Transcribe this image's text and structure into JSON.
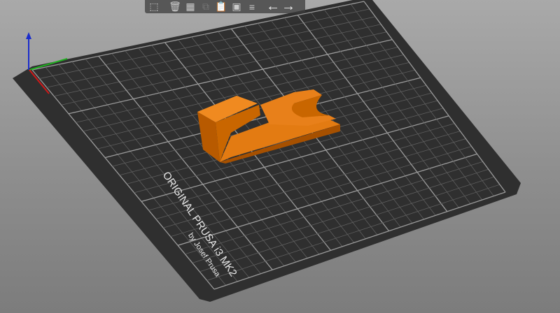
{
  "bed": {
    "label_line1": "ORIGINAL PRUSA i3  MK2",
    "label_line2": "by Josef Prusa"
  },
  "toolbar": {
    "items": [
      {
        "name": "add-object",
        "icon": "cube-plus-icon",
        "glyph": "⬚",
        "enabled": true
      },
      {
        "name": "delete",
        "icon": "trash-icon",
        "glyph": "🗑",
        "enabled": true
      },
      {
        "name": "arrange",
        "icon": "arrange-icon",
        "glyph": "▦",
        "enabled": true
      },
      {
        "name": "copy",
        "icon": "copy-icon",
        "glyph": "⧉",
        "enabled": false
      },
      {
        "name": "paste",
        "icon": "paste-icon",
        "glyph": "📋",
        "enabled": false
      },
      {
        "name": "instance",
        "icon": "instance-icon",
        "glyph": "▣",
        "enabled": true
      },
      {
        "name": "layers",
        "icon": "layers-icon",
        "glyph": "≡",
        "enabled": true
      },
      {
        "name": "undo",
        "icon": "arrow-left-icon",
        "glyph": "←",
        "enabled": true
      },
      {
        "name": "redo",
        "icon": "arrow-right-icon",
        "glyph": "→",
        "enabled": false
      }
    ]
  },
  "colors": {
    "bed": "#2e2e2e",
    "grid": "#6a6a6a",
    "object": "#e07a10",
    "axis_x": "#d01010",
    "axis_y": "#10a010",
    "axis_z": "#1020c0"
  }
}
